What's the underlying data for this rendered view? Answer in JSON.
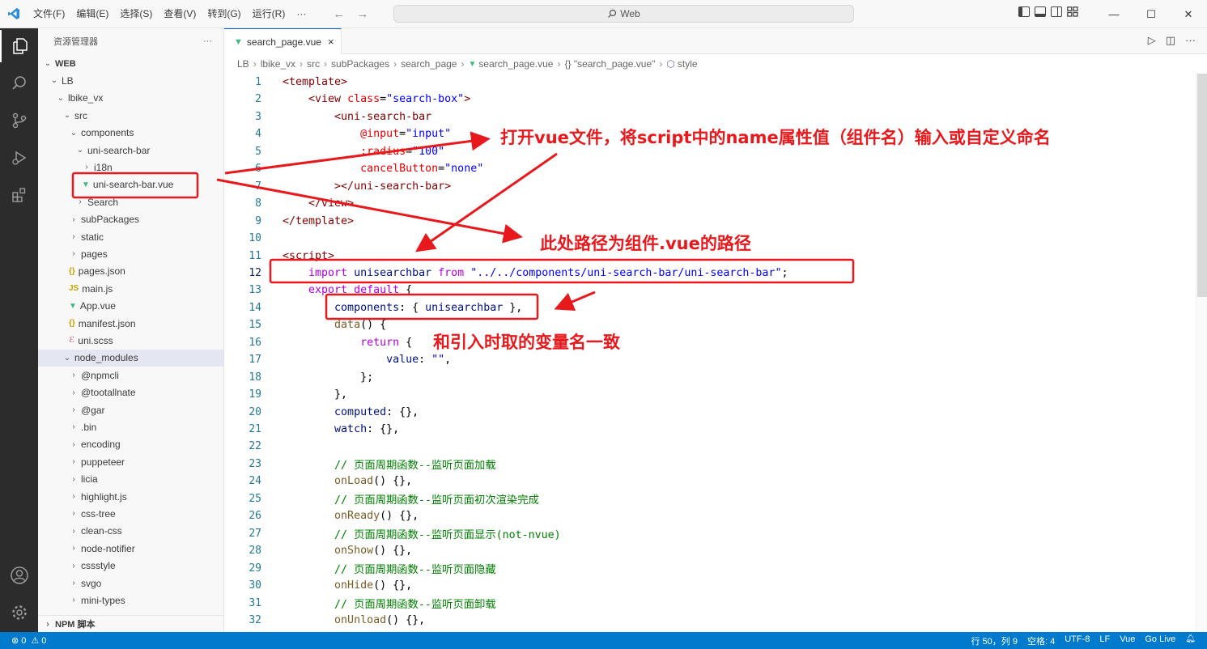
{
  "titlebar": {
    "menu": [
      "文件(F)",
      "编辑(E)",
      "选择(S)",
      "查看(V)",
      "转到(G)",
      "运行(R)",
      "···"
    ],
    "search": "Web"
  },
  "sidebar": {
    "title": "资源管理器",
    "more": "···",
    "items": [
      {
        "label": "WEB",
        "chev": "⌄",
        "indent": 0,
        "bold": true
      },
      {
        "label": "LB",
        "chev": "⌄",
        "indent": 1
      },
      {
        "label": "lbike_vx",
        "chev": "⌄",
        "indent": 2
      },
      {
        "label": "src",
        "chev": "⌄",
        "indent": 3
      },
      {
        "label": "components",
        "chev": "⌄",
        "indent": 4
      },
      {
        "label": "uni-search-bar",
        "chev": "⌄",
        "indent": 5
      },
      {
        "label": "i18n",
        "chev": "›",
        "indent": 6
      },
      {
        "label": "uni-search-bar.vue",
        "icon": "▼",
        "iconColor": "#41b883",
        "indent": 6
      },
      {
        "label": "Search",
        "chev": "›",
        "indent": 5
      },
      {
        "label": "subPackages",
        "chev": "›",
        "indent": 4
      },
      {
        "label": "static",
        "chev": "›",
        "indent": 4
      },
      {
        "label": "pages",
        "chev": "›",
        "indent": 4
      },
      {
        "label": "pages.json",
        "icon": "{}",
        "iconColor": "#c8a200",
        "indent": 4
      },
      {
        "label": "main.js",
        "icon": "JS",
        "iconColor": "#c8a200",
        "indent": 4
      },
      {
        "label": "App.vue",
        "icon": "▼",
        "iconColor": "#41b883",
        "indent": 4
      },
      {
        "label": "manifest.json",
        "icon": "{}",
        "iconColor": "#c8a200",
        "indent": 4
      },
      {
        "label": "uni.scss",
        "icon": "ℰ",
        "iconColor": "#e06c96",
        "indent": 4
      },
      {
        "label": "node_modules",
        "chev": "⌄",
        "indent": 3,
        "selected": true
      },
      {
        "label": "@npmcli",
        "chev": "›",
        "indent": 4
      },
      {
        "label": "@tootallnate",
        "chev": "›",
        "indent": 4
      },
      {
        "label": "@gar",
        "chev": "›",
        "indent": 4
      },
      {
        "label": ".bin",
        "chev": "›",
        "indent": 4
      },
      {
        "label": "encoding",
        "chev": "›",
        "indent": 4
      },
      {
        "label": "puppeteer",
        "chev": "›",
        "indent": 4
      },
      {
        "label": "licia",
        "chev": "›",
        "indent": 4
      },
      {
        "label": "highlight.js",
        "chev": "›",
        "indent": 4
      },
      {
        "label": "css-tree",
        "chev": "›",
        "indent": 4
      },
      {
        "label": "clean-css",
        "chev": "›",
        "indent": 4
      },
      {
        "label": "node-notifier",
        "chev": "›",
        "indent": 4
      },
      {
        "label": "cssstyle",
        "chev": "›",
        "indent": 4
      },
      {
        "label": "svgo",
        "chev": "›",
        "indent": 4
      },
      {
        "label": "mini-types",
        "chev": "›",
        "indent": 4
      }
    ],
    "npm": "NPM 脚本"
  },
  "tab": {
    "label": "search_page.vue",
    "close": "×"
  },
  "breadcrumb": [
    "LB",
    "lbike_vx",
    "src",
    "subPackages",
    "search_page",
    "search_page.vue",
    "{} \"search_page.vue\"",
    "style"
  ],
  "code": [
    [
      [
        "t-tag",
        "<template>"
      ]
    ],
    [
      [
        "t-pun",
        "    "
      ],
      [
        "t-tag",
        "<view "
      ],
      [
        "t-attr",
        "class"
      ],
      [
        "t-pun",
        "="
      ],
      [
        "t-str",
        "\"search-box\""
      ],
      [
        "t-tag",
        ">"
      ]
    ],
    [
      [
        "t-pun",
        "        "
      ],
      [
        "t-tag",
        "<uni-search-bar"
      ]
    ],
    [
      [
        "t-pun",
        "            "
      ],
      [
        "t-attr",
        "@input"
      ],
      [
        "t-pun",
        "="
      ],
      [
        "t-str",
        "\"input\""
      ]
    ],
    [
      [
        "t-pun",
        "            "
      ],
      [
        "t-attr",
        ":radius"
      ],
      [
        "t-pun",
        "="
      ],
      [
        "t-str",
        "\"100\""
      ]
    ],
    [
      [
        "t-pun",
        "            "
      ],
      [
        "t-attr",
        "cancelButton"
      ],
      [
        "t-pun",
        "="
      ],
      [
        "t-str",
        "\"none\""
      ]
    ],
    [
      [
        "t-pun",
        "        "
      ],
      [
        "t-tag",
        "></uni-search-bar>"
      ]
    ],
    [
      [
        "t-pun",
        "    "
      ],
      [
        "t-tag",
        "</view>"
      ]
    ],
    [
      [
        "t-tag",
        "</template>"
      ]
    ],
    [],
    [
      [
        "t-tag",
        "<script>"
      ]
    ],
    [
      [
        "t-pun",
        "    "
      ],
      [
        "t-kw2",
        "import "
      ],
      [
        "t-var",
        "unisearchbar "
      ],
      [
        "t-kw2",
        "from "
      ],
      [
        "t-str",
        "\"../../components/uni-search-bar/uni-search-bar\""
      ],
      [
        "t-pun",
        ";"
      ]
    ],
    [
      [
        "t-pun",
        "    "
      ],
      [
        "t-kw2",
        "export default "
      ],
      [
        "t-pun",
        "{"
      ]
    ],
    [
      [
        "t-pun",
        "        "
      ],
      [
        "t-var",
        "components"
      ],
      [
        "t-pun",
        ": { "
      ],
      [
        "t-var",
        "unisearchbar"
      ],
      [
        "t-pun",
        " },"
      ]
    ],
    [
      [
        "t-pun",
        "        "
      ],
      [
        "t-fn",
        "data"
      ],
      [
        "t-pun",
        "() {"
      ]
    ],
    [
      [
        "t-pun",
        "            "
      ],
      [
        "t-kw2",
        "return "
      ],
      [
        "t-pun",
        "{"
      ]
    ],
    [
      [
        "t-pun",
        "                "
      ],
      [
        "t-var",
        "value"
      ],
      [
        "t-pun",
        ": "
      ],
      [
        "t-str",
        "\"\""
      ],
      [
        "t-pun",
        ","
      ]
    ],
    [
      [
        "t-pun",
        "            };"
      ]
    ],
    [
      [
        "t-pun",
        "        },"
      ]
    ],
    [
      [
        "t-pun",
        "        "
      ],
      [
        "t-var",
        "computed"
      ],
      [
        "t-pun",
        ": {},"
      ]
    ],
    [
      [
        "t-pun",
        "        "
      ],
      [
        "t-var",
        "watch"
      ],
      [
        "t-pun",
        ": {},"
      ]
    ],
    [],
    [
      [
        "t-pun",
        "        "
      ],
      [
        "t-com",
        "// 页面周期函数--监听页面加载"
      ]
    ],
    [
      [
        "t-pun",
        "        "
      ],
      [
        "t-fn",
        "onLoad"
      ],
      [
        "t-pun",
        "() {},"
      ]
    ],
    [
      [
        "t-pun",
        "        "
      ],
      [
        "t-com",
        "// 页面周期函数--监听页面初次渲染完成"
      ]
    ],
    [
      [
        "t-pun",
        "        "
      ],
      [
        "t-fn",
        "onReady"
      ],
      [
        "t-pun",
        "() {},"
      ]
    ],
    [
      [
        "t-pun",
        "        "
      ],
      [
        "t-com",
        "// 页面周期函数--监听页面显示(not-nvue)"
      ]
    ],
    [
      [
        "t-pun",
        "        "
      ],
      [
        "t-fn",
        "onShow"
      ],
      [
        "t-pun",
        "() {},"
      ]
    ],
    [
      [
        "t-pun",
        "        "
      ],
      [
        "t-com",
        "// 页面周期函数--监听页面隐藏"
      ]
    ],
    [
      [
        "t-pun",
        "        "
      ],
      [
        "t-fn",
        "onHide"
      ],
      [
        "t-pun",
        "() {},"
      ]
    ],
    [
      [
        "t-pun",
        "        "
      ],
      [
        "t-com",
        "// 页面周期函数--监听页面卸载"
      ]
    ],
    [
      [
        "t-pun",
        "        "
      ],
      [
        "t-fn",
        "onUnload"
      ],
      [
        "t-pun",
        "() {},"
      ]
    ]
  ],
  "annotations": {
    "a1": "打开vue文件，将script中的name属性值（组件名）输入或自定义命名",
    "a2": "此处路径为组件.vue的路径",
    "a3": "和引入时取的变量名一致"
  },
  "status": {
    "errors": "0",
    "warnings": "0",
    "right": [
      "行 50，列 9",
      "空格: 4",
      "UTF-8",
      "LF",
      "Vue",
      "Go Live"
    ]
  },
  "colors": {
    "accent": "#007acc",
    "annotation": "#e8191c"
  }
}
